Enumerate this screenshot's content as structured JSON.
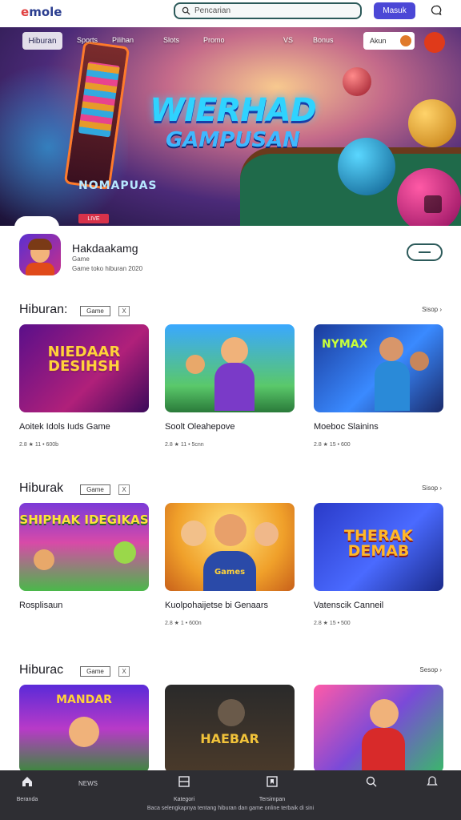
{
  "header": {
    "logo": "mole",
    "logo_prefix": "e",
    "search_placeholder": "Pencarian",
    "primary_button": "Masuk",
    "icon": "chat-bubble-icon"
  },
  "hero": {
    "nav": {
      "active": "Hiburan",
      "links": [
        "Sports",
        "Pilihan",
        "Slots",
        "Promo",
        "VS",
        "Bonus"
      ],
      "user": "Akun"
    },
    "title_line1": "WIERHAD",
    "title_line2": "GAMPUSAN",
    "subtitle": "NOMAPUAS",
    "badge": "LIVE"
  },
  "profile": {
    "name": "Hakdaakamg",
    "line1": "Game",
    "line2": "Game toko hiburan 2020"
  },
  "sections": [
    {
      "title": "Hiburan:",
      "pill": "Game",
      "x": "X",
      "more": "Sisop ›",
      "cards": [
        {
          "title": "Aoitek Idols Iuds Game",
          "meta": "2.8 ★ 11 • 600b",
          "thumb": "NIEDAAR DESIHSH"
        },
        {
          "title": "Soolt Oleahepove",
          "meta": "2.8 ★ 11 • 5cnn",
          "thumb": ""
        },
        {
          "title": "Moeboc Slainins",
          "meta": "2.8 ★ 15 • 600",
          "thumb": "NYMAX"
        }
      ]
    },
    {
      "title": "Hiburak",
      "pill": "Game",
      "x": "X",
      "more": "Sisop ›",
      "cards": [
        {
          "title": "Rosplisaun",
          "meta": "",
          "thumb": "SHIPHAK IDEGIKAS"
        },
        {
          "title": "Kuolpohaijetse bi Genaars",
          "meta": "2.8 ★ 1 • 600n",
          "thumb": "Games"
        },
        {
          "title": "Vatenscik Canneil",
          "meta": "2.8 ★ 15 • 500",
          "thumb": "THERAK DEMAB"
        }
      ]
    },
    {
      "title": "Hiburac",
      "pill": "Game",
      "x": "X",
      "more": "Sesop ›",
      "cards": [
        {
          "title": "",
          "meta": "",
          "thumb": "MANDAR"
        },
        {
          "title": "",
          "meta": "",
          "thumb": "HAEBAR"
        },
        {
          "title": "",
          "meta": "",
          "thumb": ""
        }
      ]
    }
  ],
  "bottom_nav": {
    "items": [
      {
        "label": "Beranda",
        "icon": "home-icon"
      },
      {
        "label": "Kategori",
        "icon": "grid-icon"
      },
      {
        "label": "Tersimpan",
        "icon": "bookmark-icon"
      },
      {
        "label": "",
        "icon": "search-icon"
      },
      {
        "label": "",
        "icon": "bell-icon"
      }
    ],
    "extra": "NEWS",
    "footer": "Baca selengkapnya tentang hiburan dan game online terbaik di sini"
  }
}
